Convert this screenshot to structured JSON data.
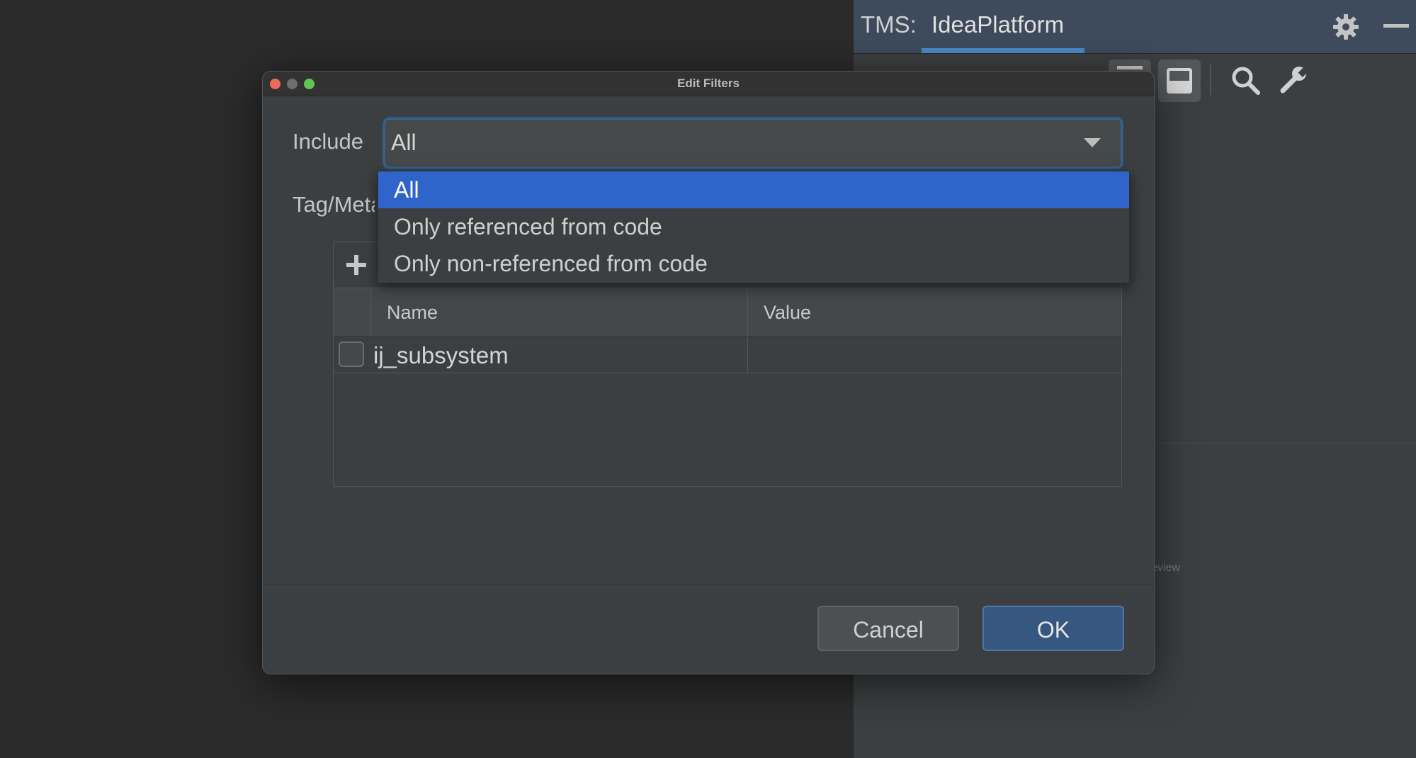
{
  "tool_window": {
    "prefix": "TMS:",
    "tab": "IdeaPlatform",
    "faint_text": "eview",
    "icons": [
      "gear-icon",
      "minimize-icon",
      "search-icon",
      "wrench-icon"
    ]
  },
  "dialog": {
    "title": "Edit Filters",
    "include_label": "Include",
    "include_value": "All",
    "tag_label": "Tag/Metadata",
    "table": {
      "columns": [
        "Name",
        "Value"
      ],
      "rows": [
        {
          "checked": false,
          "name": "ij_subsystem",
          "value": ""
        }
      ]
    },
    "cancel_label": "Cancel",
    "ok_label": "OK"
  },
  "dropdown": {
    "options": [
      "All",
      "Only referenced from code",
      "Only non-referenced from code"
    ],
    "selected_index": 0
  },
  "colors": {
    "selection": "#2f65ca",
    "ok_button": "#365880",
    "tab_underline": "#4a88c7"
  }
}
